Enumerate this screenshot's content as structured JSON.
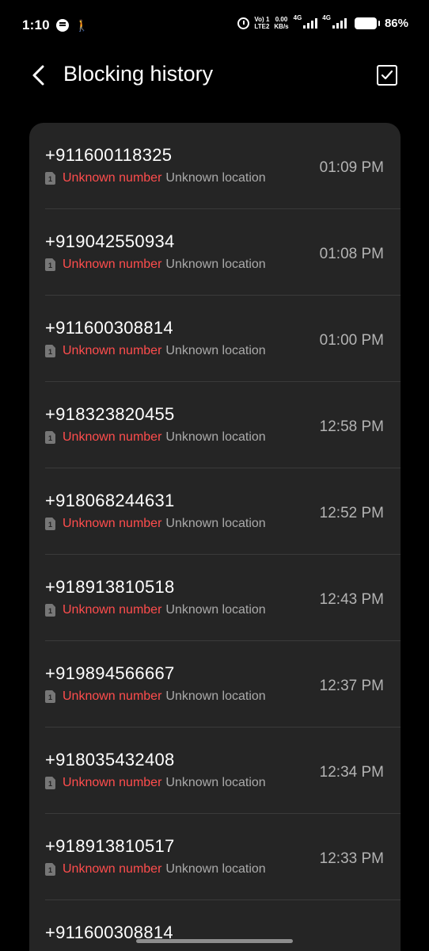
{
  "status_bar": {
    "time": "1:10",
    "net_top": "Vo) 1",
    "net_bottom": "LTE2",
    "speed_value": "0.00",
    "speed_unit": "KB/s",
    "sim1_type": "4G",
    "sim2_type": "4G",
    "battery": "86%"
  },
  "header": {
    "title": "Blocking history"
  },
  "blocked_calls": [
    {
      "number": "+911600118325",
      "status": "Unknown number",
      "location": "Unknown location",
      "time": "01:09 PM",
      "sim": "1"
    },
    {
      "number": "+919042550934",
      "status": "Unknown number",
      "location": "Unknown location",
      "time": "01:08 PM",
      "sim": "1"
    },
    {
      "number": "+911600308814",
      "status": "Unknown number",
      "location": "Unknown location",
      "time": "01:00 PM",
      "sim": "1"
    },
    {
      "number": "+918323820455",
      "status": "Unknown number",
      "location": "Unknown location",
      "time": "12:58 PM",
      "sim": "1"
    },
    {
      "number": "+918068244631",
      "status": "Unknown number",
      "location": "Unknown location",
      "time": "12:52 PM",
      "sim": "1"
    },
    {
      "number": "+918913810518",
      "status": "Unknown number",
      "location": "Unknown location",
      "time": "12:43 PM",
      "sim": "1"
    },
    {
      "number": "+919894566667",
      "status": "Unknown number",
      "location": "Unknown location",
      "time": "12:37 PM",
      "sim": "1"
    },
    {
      "number": "+918035432408",
      "status": "Unknown number",
      "location": "Unknown location",
      "time": "12:34 PM",
      "sim": "1"
    },
    {
      "number": "+918913810517",
      "status": "Unknown number",
      "location": "Unknown location",
      "time": "12:33 PM",
      "sim": "1"
    },
    {
      "number": "+911600308814",
      "status": "",
      "location": "",
      "time": "",
      "sim": ""
    }
  ],
  "colors": {
    "background": "#000000",
    "card": "#252525",
    "unknown_red": "#ff4d4d",
    "secondary_text": "#aaaaaa"
  }
}
